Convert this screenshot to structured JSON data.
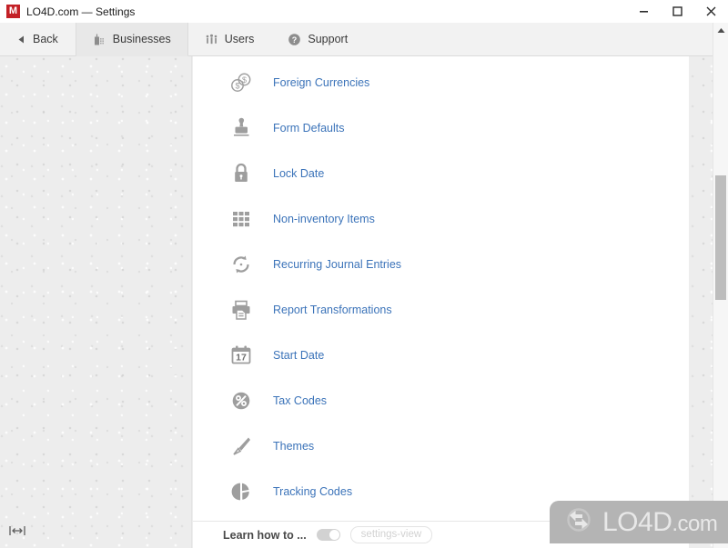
{
  "window": {
    "title": "LO4D.com — Settings",
    "logo_letter": "M",
    "controls": {
      "minimize": "minimize-button",
      "maximize": "maximize-button",
      "close": "close-button"
    }
  },
  "tabs": [
    {
      "label": "Back",
      "icon": "back-arrow-icon",
      "active": false
    },
    {
      "label": "Businesses",
      "icon": "building-icon",
      "active": true
    },
    {
      "label": "Users",
      "icon": "people-icon",
      "active": false
    },
    {
      "label": "Support",
      "icon": "question-mark-circle-icon",
      "active": false
    }
  ],
  "settings": {
    "items": [
      {
        "label": "Foreign Currencies",
        "icon": "coins-dollar-icon"
      },
      {
        "label": "Form Defaults",
        "icon": "rubber-stamp-icon"
      },
      {
        "label": "Lock Date",
        "icon": "padlock-icon"
      },
      {
        "label": "Non-inventory Items",
        "icon": "grid-squares-icon"
      },
      {
        "label": "Recurring Journal Entries",
        "icon": "circular-arrows-icon"
      },
      {
        "label": "Report Transformations",
        "icon": "printer-icon"
      },
      {
        "label": "Start Date",
        "icon": "calendar-icon",
        "calendar_day": "17"
      },
      {
        "label": "Tax Codes",
        "icon": "percent-circle-icon"
      },
      {
        "label": "Themes",
        "icon": "paintbrush-icon"
      },
      {
        "label": "Tracking Codes",
        "icon": "pie-chart-icon"
      }
    ]
  },
  "status_bar": {
    "learn_label": "Learn how to ...",
    "toggle_state": "on",
    "view_badge": "settings-view"
  },
  "resize_widget": {
    "icon": "horizontal-resize-icon"
  },
  "scrollbar": {
    "up_icon": "scroll-up-arrow-icon",
    "down_icon": "scroll-down-arrow-icon",
    "thumb": "scrollbar-thumb"
  },
  "watermark": {
    "text": "LO4D",
    "suffix": ".com",
    "icon": "lo4d-circular-arrows-logo"
  },
  "colors": {
    "link": "#3b73b9",
    "icon_gray": "#a0a0a0",
    "logo_red": "#c32026",
    "tab_active_bg": "#e8e8e8",
    "watermark_bg": "#b4b4b4"
  }
}
